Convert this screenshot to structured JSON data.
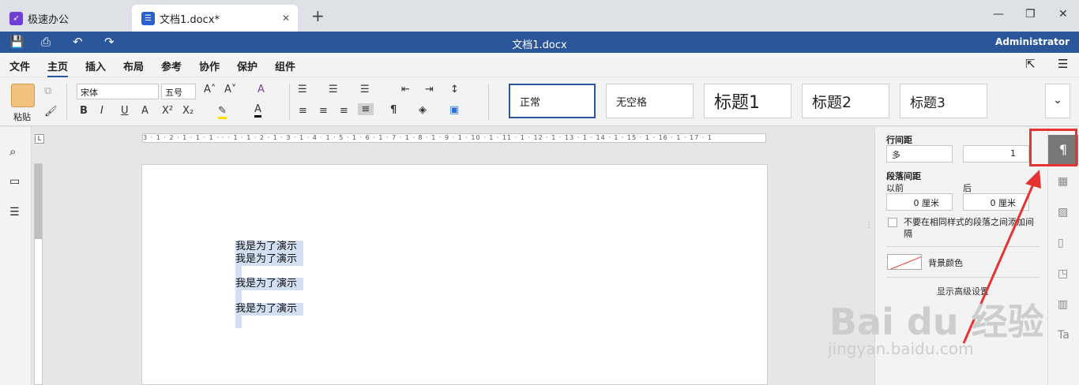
{
  "tabs": [
    {
      "label": "极速办公",
      "icon": "rocket-icon",
      "color": "#6f3fd4"
    },
    {
      "label": "文档1.docx*",
      "icon": "doc-icon",
      "color": "#2b5fcf"
    }
  ],
  "titlebar": {
    "title": "文档1.docx",
    "user": "Administrator"
  },
  "menu": [
    "文件",
    "主页",
    "插入",
    "布局",
    "参考",
    "协作",
    "保护",
    "组件"
  ],
  "ribbon": {
    "paste": "粘贴",
    "font": "宋体",
    "size": "五号",
    "styles": [
      "正常",
      "无空格",
      "标题1",
      "标题2",
      "标题3"
    ]
  },
  "ruler": "3 · 1 · 2 · 1 · 1 · 1 · · · 1 · 1 · 2 · 1 · 3 · 1 · 4 · 1 · 5 · 1 · 6 · 1 · 7 · 1 · 8 · 1 · 9 · 1 · 10 · 1 · 11 · 1 · 12 · 1 · 13 · 1 · 14 · 1 · 15 · 1 · 16 · 1 · 17 · 1",
  "document": {
    "lines": [
      "我是为了演示",
      "我是为了演示",
      "我是为了演示",
      "我是为了演示"
    ]
  },
  "panel": {
    "line_spacing_label": "行间距",
    "line_spacing_mode": "多",
    "line_spacing_value": "1",
    "para_spacing_label": "段落间距",
    "before_label": "以前",
    "after_label": "后",
    "before_value": "0 厘米",
    "after_value": "0 厘米",
    "checkbox_label": "不要在相同样式的段落之间添加间隔",
    "bg_color_label": "背景颜色",
    "advanced_label": "显示高级设置"
  },
  "watermark": {
    "line1": "Bai du 经验",
    "line2": "jingyan.baidu.com"
  }
}
